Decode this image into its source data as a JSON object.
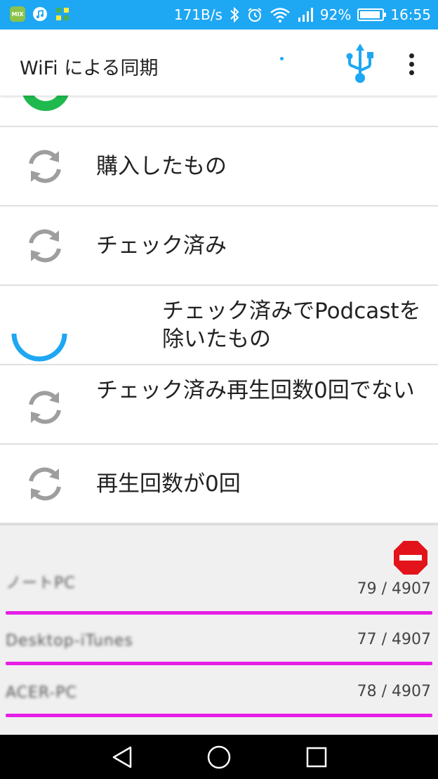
{
  "status_bar": {
    "app_icons": [
      "mix-app-icon",
      "music-app-icon",
      "cross-app-icon"
    ],
    "mix_label": "MIX",
    "net_speed": "171B/s",
    "battery_percent": "92%",
    "battery_level": 0.92,
    "time": "16:55"
  },
  "app_bar": {
    "title": "WiFi による同期"
  },
  "list": {
    "items": [
      {
        "label": "購入したもの",
        "icon": "sync-icon"
      },
      {
        "label": "チェック済み",
        "icon": "sync-icon"
      },
      {
        "label": "チェック済みでPodcastを除いたもの",
        "icon": "loading-spinner-icon"
      },
      {
        "label": "チェック済み再生回数0回でない",
        "icon": "sync-icon"
      },
      {
        "label": "再生回数が0回",
        "icon": "sync-icon"
      }
    ]
  },
  "devices": [
    {
      "name": "ノートPC",
      "count": "79 / 4907",
      "progress": 0.016
    },
    {
      "name": "Desktop-iTunes",
      "count": "77 / 4907",
      "progress": 0.016
    },
    {
      "name": "ACER-PC",
      "count": "78 / 4907",
      "progress": 0.016
    }
  ],
  "colors": {
    "status_bar": "#1ea7f2",
    "accent": "#1ea7f2",
    "sync_icon": "#9e9e9e",
    "progress_bar": "#e61ee6",
    "stop_icon": "#e2131a",
    "green": "#20b94e"
  }
}
